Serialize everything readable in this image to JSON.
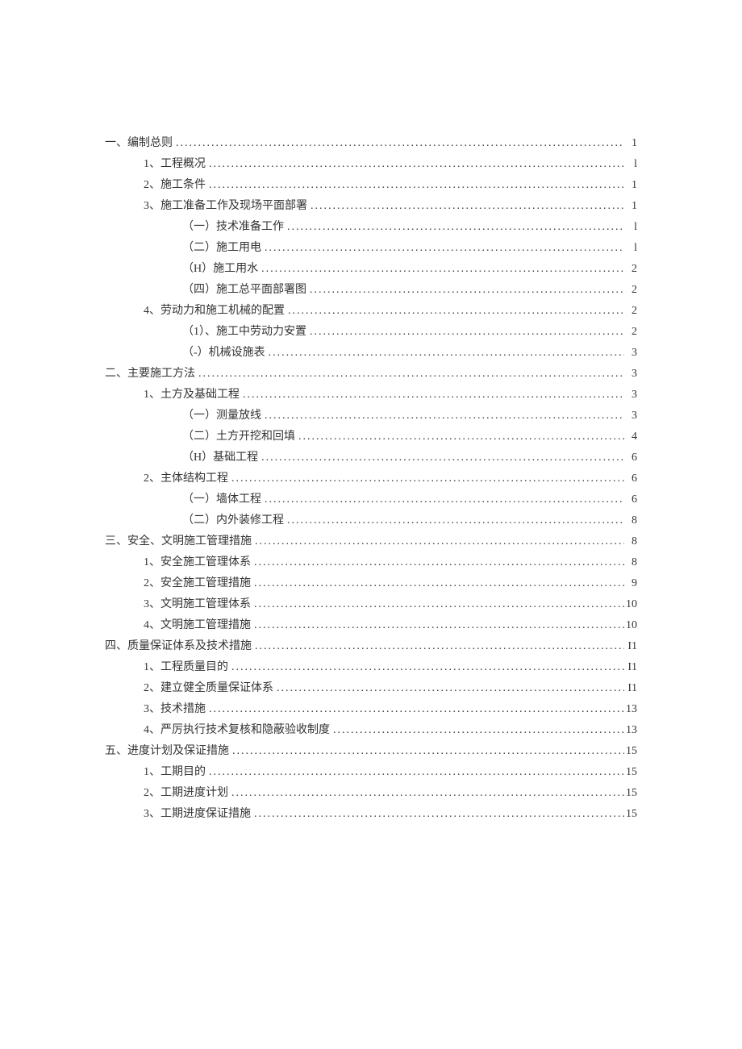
{
  "toc": [
    {
      "level": 0,
      "label": "一、编制总则",
      "page": "1"
    },
    {
      "level": 1,
      "label": "1、工程概况",
      "page": "l"
    },
    {
      "level": 1,
      "label": "2、施工条件",
      "page": "1"
    },
    {
      "level": 1,
      "label": "3、施工准备工作及现场平面部署",
      "page": "1"
    },
    {
      "level": 2,
      "label": "（一）技术准备工作",
      "page": "l"
    },
    {
      "level": 2,
      "label": "（二）施工用电",
      "page": "l"
    },
    {
      "level": 2,
      "label": "（H）施工用水",
      "page": "2"
    },
    {
      "level": 2,
      "label": "（四）施工总平面部署图",
      "page": "2"
    },
    {
      "level": 1,
      "label": "4、劳动力和施工机械的配置",
      "page": "2"
    },
    {
      "level": 2,
      "label": "（1）、施工中劳动力安置",
      "page": "2"
    },
    {
      "level": 2,
      "label": "（-）机械设施表",
      "page": "3"
    },
    {
      "level": 0,
      "label": "二、主要施工方法",
      "page": "3"
    },
    {
      "level": 1,
      "label": "1、土方及基础工程",
      "page": "3"
    },
    {
      "level": 2,
      "label": "（一）测量放线",
      "page": "3"
    },
    {
      "level": 2,
      "label": "（二）土方开挖和回填",
      "page": "4"
    },
    {
      "level": 2,
      "label": "（H）基础工程",
      "page": "6"
    },
    {
      "level": 1,
      "label": "2、主体结构工程",
      "page": "6"
    },
    {
      "level": 2,
      "label": "（一）墙体工程",
      "page": "6"
    },
    {
      "level": 2,
      "label": "（二）内外装修工程",
      "page": "8"
    },
    {
      "level": 0,
      "label": "三、安全、文明施工管理措施",
      "page": "8"
    },
    {
      "level": 1,
      "label": "1、安全施工管理体系",
      "page": "8"
    },
    {
      "level": 1,
      "label": "2、安全施工管理措施",
      "page": "9"
    },
    {
      "level": 1,
      "label": "3、文明施工管理体系",
      "page": "10"
    },
    {
      "level": 1,
      "label": "4、文明施工管理措施",
      "page": "10"
    },
    {
      "level": 0,
      "label": "四、质量保证体系及技术措施",
      "page": "I1"
    },
    {
      "level": 1,
      "label": "1、工程质量目的",
      "page": "I1"
    },
    {
      "level": 1,
      "label": "2、建立健全质量保证体系",
      "page": "I1"
    },
    {
      "level": 1,
      "label": "3、技术措施",
      "page": "13"
    },
    {
      "level": 1,
      "label": "4、严厉执行技术复核和隐蔽验收制度",
      "page": "13"
    },
    {
      "level": 0,
      "label": "五、进度计划及保证措施",
      "page": "15"
    },
    {
      "level": 1,
      "label": "1、工期目的",
      "page": "15"
    },
    {
      "level": 1,
      "label": "2、工期进度计划",
      "page": "15"
    },
    {
      "level": 1,
      "label": "3、工期进度保证措施",
      "page": "15"
    }
  ]
}
